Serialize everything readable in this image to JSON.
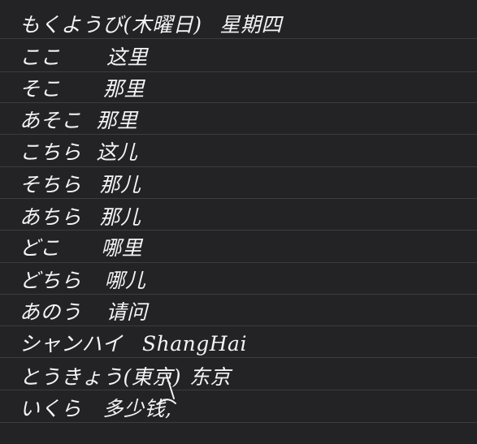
{
  "notes": {
    "lines": [
      {
        "jp": "もくようび(木曜日)",
        "cn": "星期四"
      },
      {
        "jp": "ここ",
        "cn": "这里"
      },
      {
        "jp": "そこ",
        "cn": "那里"
      },
      {
        "jp": "あそこ",
        "cn": "那里"
      },
      {
        "jp": "こちら",
        "cn": "这儿"
      },
      {
        "jp": "そちら",
        "cn": "那儿"
      },
      {
        "jp": "あちら",
        "cn": "那儿"
      },
      {
        "jp": "どこ",
        "cn": "哪里"
      },
      {
        "jp": "どちら",
        "cn": "哪儿"
      },
      {
        "jp": "あのう",
        "cn": "请问"
      },
      {
        "jp": "シャンハイ",
        "cn": "ShangHai"
      },
      {
        "jp": "とうきょう(東京)",
        "cn": "东京"
      },
      {
        "jp": "いくら",
        "cn": "多少钱,"
      }
    ]
  },
  "colors": {
    "background": "#232326",
    "ruled_line": "#3b3b41",
    "ink": "#f4f4f4"
  }
}
